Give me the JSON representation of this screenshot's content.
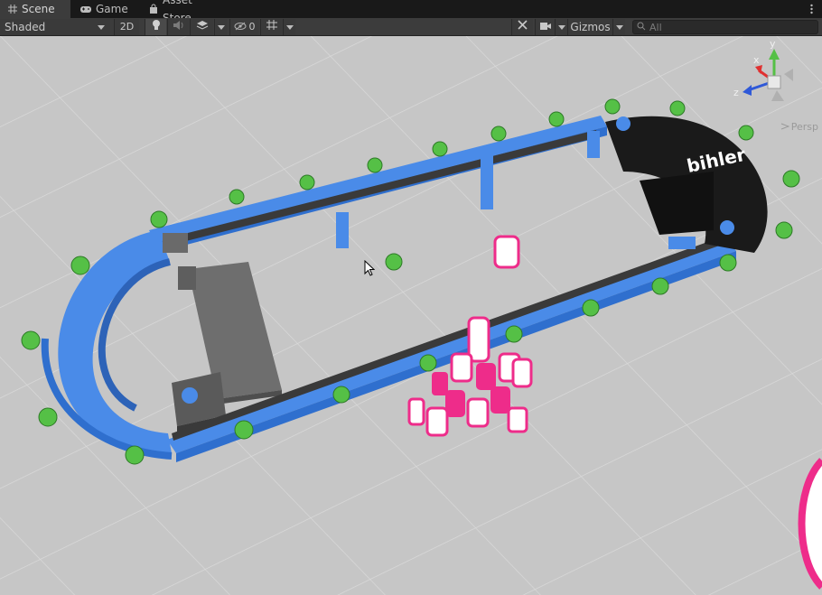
{
  "tabs": [
    {
      "label": "Scene",
      "icon": "grid-icon"
    },
    {
      "label": "Game",
      "icon": "gamepad-icon"
    },
    {
      "label": "Asset Store",
      "icon": "shopping-bag-icon"
    }
  ],
  "toolbar": {
    "draw_mode": "Shaded",
    "mode_2d": "2D",
    "hidden_count": "0",
    "gizmos_label": "Gizmos",
    "search_placeholder": "All"
  },
  "viewport": {
    "projection_label": "Persp",
    "logo_text": "bihler",
    "axis_x": "x",
    "axis_y": "y",
    "axis_z": "z"
  },
  "colors": {
    "conveyor_blue": "#4a8be8",
    "drum_black": "#1a1a1a",
    "ground": "#c7c7c7",
    "grid_line": "#d8d8d8",
    "can_pink": "#ee2c8a",
    "plant_green": "#55c046"
  }
}
